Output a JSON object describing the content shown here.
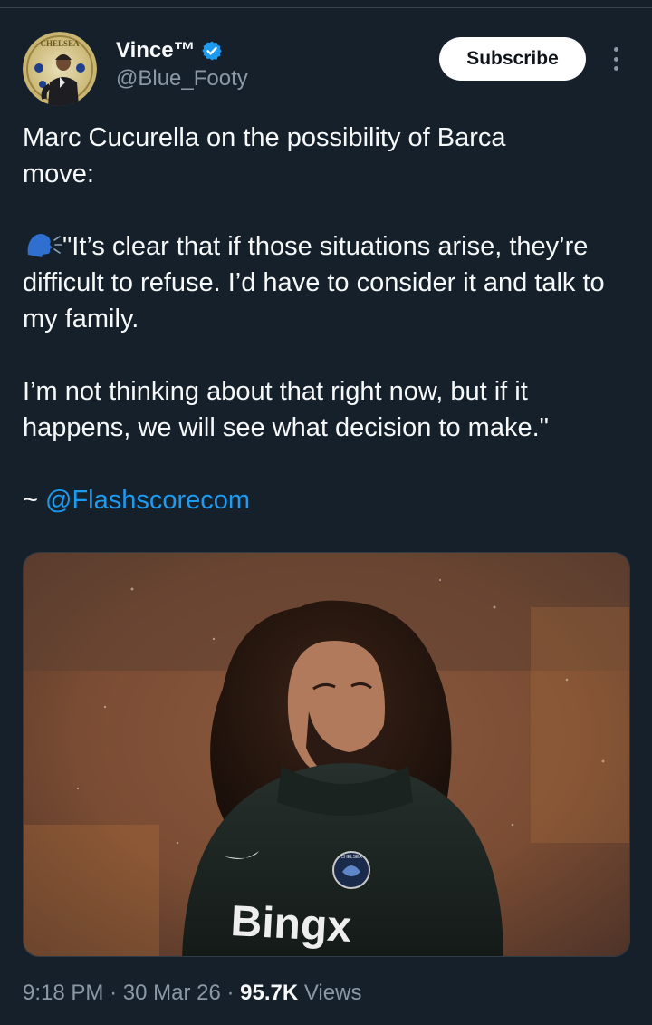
{
  "author": {
    "name": "Vince™",
    "handle": "@Blue_Footy",
    "avatar_badge_text": "CHELSEA"
  },
  "actions": {
    "subscribe_label": "Subscribe"
  },
  "tweet": {
    "line1": "Marc Cucurella on the possibility of Barca",
    "line2": "move:",
    "quote_1": "\"It’s clear that if those situations arise, they’re difficult to refuse. I’d have to consider it and talk to my family.",
    "quote_2": "I’m not thinking about that right now, but if it happens, we will see what decision to make.\"",
    "source_prefix": "~",
    "source_mention": "@Flashscorecom"
  },
  "image": {
    "shirt_text": "Bingx",
    "crest_text": "CHELSEA"
  },
  "meta": {
    "time": "9:18 PM",
    "separator": "·",
    "date": "30 Mar 26",
    "views_count": "95.7K",
    "views_label": "Views"
  },
  "colors": {
    "background": "#15202b",
    "link": "#1d9bf0",
    "verified": "#1d9bf0",
    "muted": "#8b98a5"
  },
  "icons": [
    "verified-badge-icon",
    "more-options-icon",
    "speaking-head-icon",
    "nike-swoosh-icon"
  ]
}
